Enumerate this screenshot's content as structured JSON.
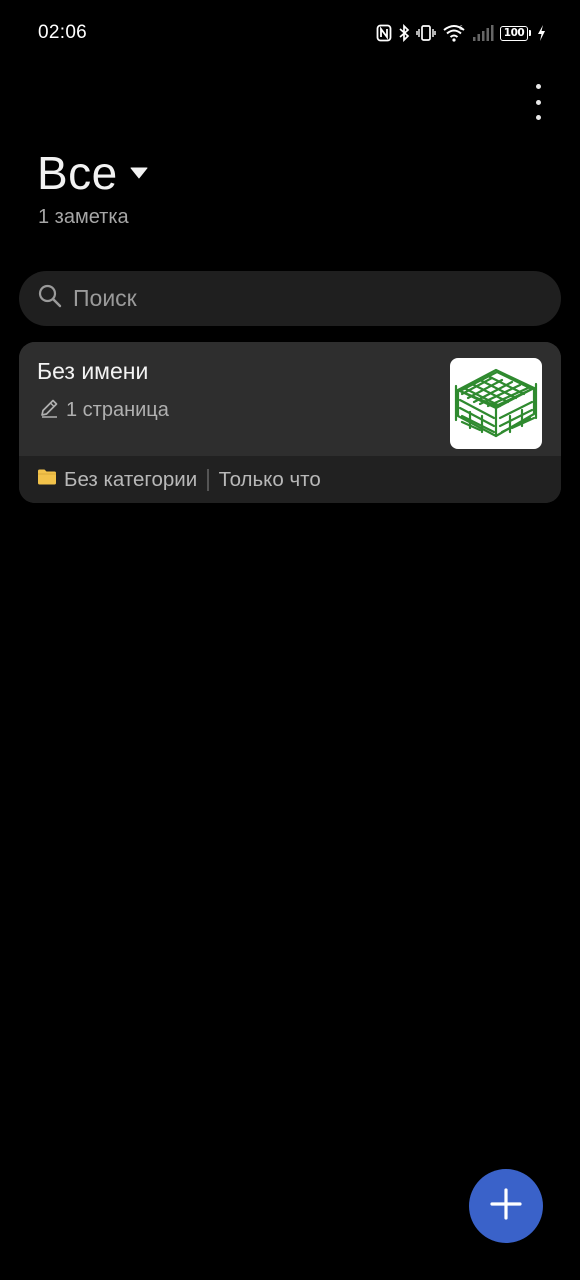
{
  "status_bar": {
    "time": "02:06",
    "battery_level": "100",
    "icons": [
      "nfc-icon",
      "bluetooth-icon",
      "vibrate-icon",
      "wifi-icon",
      "signal-icon",
      "battery-icon",
      "charging-icon"
    ]
  },
  "header": {
    "title": "Все",
    "note_count": "1 заметка",
    "more_icon": "more-vertical-icon"
  },
  "search": {
    "placeholder": "Поиск",
    "icon": "search-icon"
  },
  "notes": [
    {
      "title": "Без имени",
      "pages": "1 страница",
      "category": "Без категории",
      "time": "Только что",
      "thumbnail_icon": "green-sketch-thumbnail"
    }
  ],
  "colors": {
    "background": "#000000",
    "card": "#2e2e2e",
    "card_footer": "#212121",
    "search_bg": "#1f1f1f",
    "fab": "#3a62c9",
    "folder": "#f2c24a",
    "sketch": "#2f8a2f"
  },
  "fab": {
    "icon": "plus-icon"
  }
}
